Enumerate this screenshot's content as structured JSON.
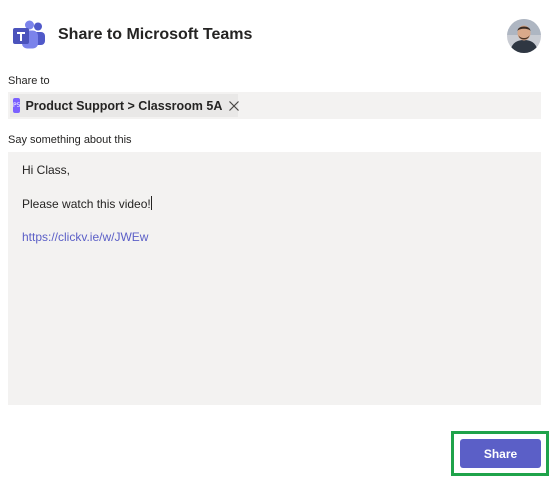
{
  "header": {
    "title": "Share to Microsoft Teams",
    "logo_icon": "microsoft-teams-logo",
    "avatar_icon": "user-avatar"
  },
  "share_to": {
    "label": "Share to",
    "chip": {
      "icon": "class-team-icon",
      "icon_text": "P5",
      "text": "Product Support > Classroom 5A",
      "remove_icon": "close-icon"
    }
  },
  "message": {
    "label": "Say something about this",
    "lines": [
      "Hi Class,",
      "Please watch this video!",
      "https://clickv.ie/w/JWEw"
    ]
  },
  "actions": {
    "share_label": "Share"
  },
  "colors": {
    "accent": "#5b5fc7",
    "highlight": "#1fa34a",
    "field_bg": "#f3f2f1",
    "chip_icon": "#7b61ff"
  }
}
